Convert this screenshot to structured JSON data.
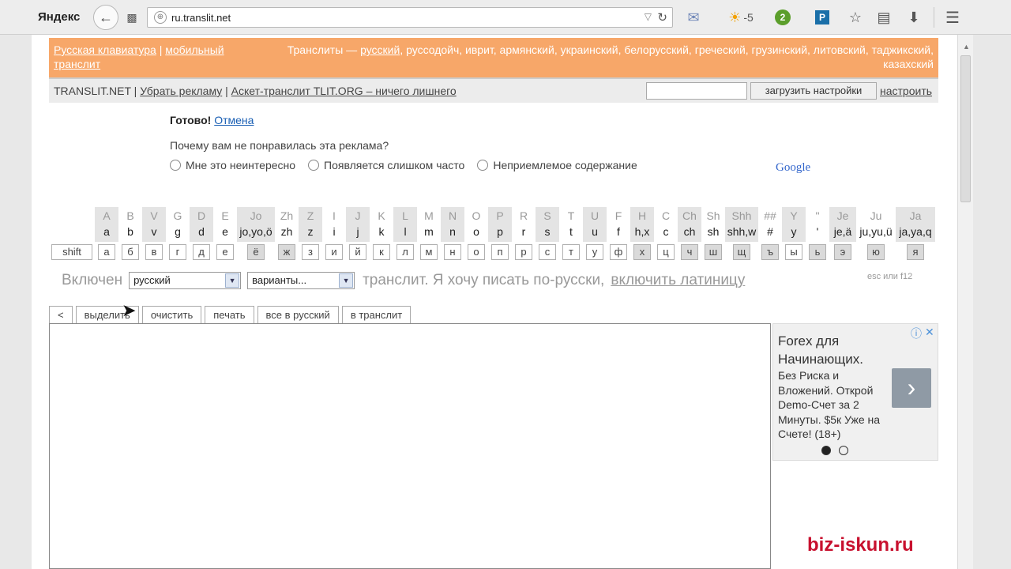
{
  "browser": {
    "logo": "Яндекс",
    "url": "ru.translit.net",
    "weather": "-5",
    "ext_badge": "2",
    "ext_p": "P"
  },
  "header": {
    "left_link1": "Русская клавиатура",
    "left_sep": " | ",
    "left_link2": "мобильный транслит",
    "right_prefix": "Транслиты — ",
    "right_link": "русский",
    "right_rest": ", руссодойч, иврит, армянский, украинский, белорусский, греческий, грузинский, литовский, таджикский, казахский"
  },
  "nav": {
    "site": "TRANSLIT.NET",
    "sep": " | ",
    "remove_ads": "Убрать рекламу",
    "ascet": "Аскет-транслит TLIT.ORG – ничего лишнего",
    "load_settings": "загрузить настройки",
    "configure": "настроить"
  },
  "ad_feedback": {
    "done": "Готово!",
    "cancel": "Отмена",
    "question": "Почему вам не понравилась эта реклама?",
    "options": [
      "Мне это неинтересно",
      "Появляется слишком часто",
      "Неприемлемое содержание"
    ],
    "google": "Google"
  },
  "keyboard": {
    "shift": "shift",
    "keys": [
      {
        "up": "A",
        "low": "a",
        "btn": "а",
        "shaded": true,
        "dark": false
      },
      {
        "up": "B",
        "low": "b",
        "btn": "б",
        "shaded": false,
        "dark": false
      },
      {
        "up": "V",
        "low": "v",
        "btn": "в",
        "shaded": true,
        "dark": false
      },
      {
        "up": "G",
        "low": "g",
        "btn": "г",
        "shaded": false,
        "dark": false
      },
      {
        "up": "D",
        "low": "d",
        "btn": "д",
        "shaded": true,
        "dark": false
      },
      {
        "up": "E",
        "low": "e",
        "btn": "е",
        "shaded": false,
        "dark": false
      },
      {
        "up": "Jo",
        "low": "jo,yo,ö",
        "btn": "ё",
        "shaded": true,
        "dark": true
      },
      {
        "up": "Zh",
        "low": "zh",
        "btn": "ж",
        "shaded": false,
        "dark": true
      },
      {
        "up": "Z",
        "low": "z",
        "btn": "з",
        "shaded": true,
        "dark": false
      },
      {
        "up": "I",
        "low": "i",
        "btn": "и",
        "shaded": false,
        "dark": false
      },
      {
        "up": "J",
        "low": "j",
        "btn": "й",
        "shaded": true,
        "dark": false
      },
      {
        "up": "K",
        "low": "k",
        "btn": "к",
        "shaded": false,
        "dark": false
      },
      {
        "up": "L",
        "low": "l",
        "btn": "л",
        "shaded": true,
        "dark": false
      },
      {
        "up": "M",
        "low": "m",
        "btn": "м",
        "shaded": false,
        "dark": false
      },
      {
        "up": "N",
        "low": "n",
        "btn": "н",
        "shaded": true,
        "dark": false
      },
      {
        "up": "O",
        "low": "o",
        "btn": "о",
        "shaded": false,
        "dark": false
      },
      {
        "up": "P",
        "low": "p",
        "btn": "п",
        "shaded": true,
        "dark": false
      },
      {
        "up": "R",
        "low": "r",
        "btn": "р",
        "shaded": false,
        "dark": false
      },
      {
        "up": "S",
        "low": "s",
        "btn": "с",
        "shaded": true,
        "dark": false
      },
      {
        "up": "T",
        "low": "t",
        "btn": "т",
        "shaded": false,
        "dark": false
      },
      {
        "up": "U",
        "low": "u",
        "btn": "у",
        "shaded": true,
        "dark": false
      },
      {
        "up": "F",
        "low": "f",
        "btn": "ф",
        "shaded": false,
        "dark": false
      },
      {
        "up": "H",
        "low": "h,x",
        "btn": "х",
        "shaded": true,
        "dark": true
      },
      {
        "up": "C",
        "low": "c",
        "btn": "ц",
        "shaded": false,
        "dark": false
      },
      {
        "up": "Ch",
        "low": "ch",
        "btn": "ч",
        "shaded": true,
        "dark": true
      },
      {
        "up": "Sh",
        "low": "sh",
        "btn": "ш",
        "shaded": false,
        "dark": true
      },
      {
        "up": "Shh",
        "low": "shh,w",
        "btn": "щ",
        "shaded": true,
        "dark": true
      },
      {
        "up": "##",
        "low": "#",
        "btn": "ъ",
        "shaded": false,
        "dark": true
      },
      {
        "up": "Y",
        "low": "y",
        "btn": "ы",
        "shaded": true,
        "dark": false
      },
      {
        "up": "''",
        "low": "'",
        "btn": "ь",
        "shaded": false,
        "dark": true
      },
      {
        "up": "Je",
        "low": "je,ä",
        "btn": "э",
        "shaded": true,
        "dark": true
      },
      {
        "up": "Ju",
        "low": "ju,yu,ü",
        "btn": "ю",
        "shaded": false,
        "dark": true
      },
      {
        "up": "Ja",
        "low": "ja,ya,q",
        "btn": "я",
        "shaded": true,
        "dark": true
      }
    ]
  },
  "mode": {
    "enabled": "Включен",
    "lang_select": "русский",
    "variants_select": "варианты...",
    "text": "транслит. Я хочу писать по-русски,",
    "latin_link": "включить латиницу",
    "hint": "esc или f12"
  },
  "actions": [
    "<",
    "выделить",
    "очистить",
    "печать",
    "все в русский",
    "в транслит"
  ],
  "ad": {
    "title": "Forex для Начинающих.",
    "body": "Без Риска и Вложений. Открой Demo-Счет за 2 Минуты. $5к Уже на Счете! (18+)"
  },
  "watermark": "biz-iskun.ru"
}
